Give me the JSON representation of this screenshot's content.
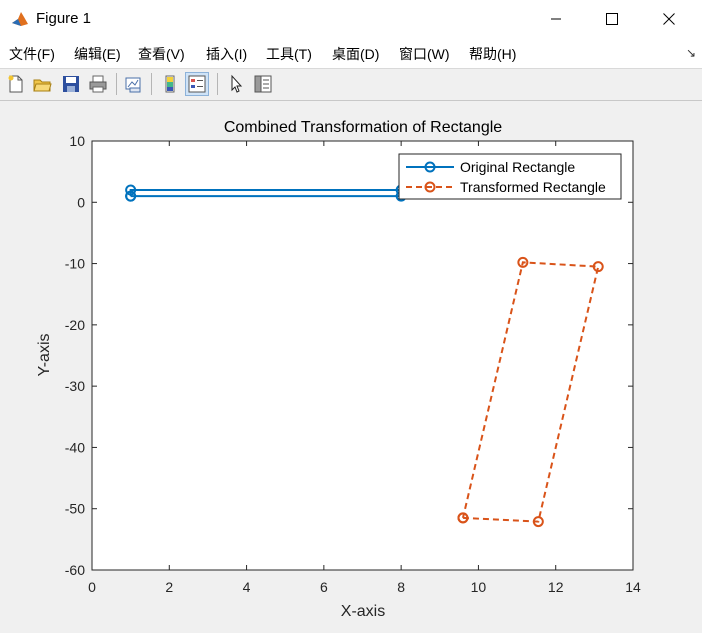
{
  "window": {
    "title": "Figure 1"
  },
  "menu": {
    "items": [
      "文件(F)",
      "编辑(E)",
      "查看(V)",
      "插入(I)",
      "工具(T)",
      "桌面(D)",
      "窗口(W)",
      "帮助(H)"
    ]
  },
  "toolbar": {
    "icons": [
      "new-figure-icon",
      "open-file-icon",
      "save-icon",
      "print-icon",
      "link-plot-icon",
      "colorbar-icon",
      "legend-icon",
      "pointer-icon",
      "property-inspector-icon"
    ]
  },
  "colors": {
    "series1": "#0072BD",
    "series2": "#D95319"
  },
  "chart_data": {
    "type": "line",
    "title": "Combined Transformation of Rectangle",
    "xlabel": "X-axis",
    "ylabel": "Y-axis",
    "xlim": [
      0,
      14
    ],
    "ylim": [
      -60,
      10
    ],
    "xticks": [
      0,
      2,
      4,
      6,
      8,
      10,
      12,
      14
    ],
    "yticks": [
      10,
      0,
      -10,
      -20,
      -30,
      -40,
      -50,
      -60
    ],
    "grid": false,
    "legend_position": "top-right",
    "series": [
      {
        "name": "Original Rectangle",
        "style": "solid-circle",
        "x": [
          1,
          8,
          8,
          1,
          1
        ],
        "y": [
          1,
          1,
          2,
          2,
          1
        ]
      },
      {
        "name": "Transformed Rectangle",
        "style": "dashed-circle",
        "x": [
          9.6,
          11.55,
          13.1,
          11.15,
          9.6
        ],
        "y": [
          -51.5,
          -52.1,
          -10.5,
          -9.8,
          -51.5
        ]
      }
    ]
  }
}
